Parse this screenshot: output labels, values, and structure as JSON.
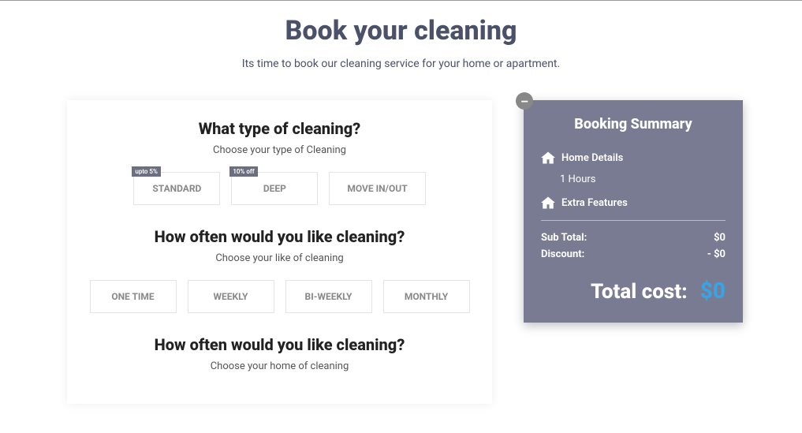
{
  "header": {
    "title": "Book your cleaning",
    "subtitle": "Its time to book our cleaning service for your home or apartment."
  },
  "form": {
    "section1": {
      "heading": "What type of cleaning?",
      "sub": "Choose your type of Cleaning",
      "options": {
        "standard": {
          "label": "STANDARD",
          "badge": "upto 5%"
        },
        "deep": {
          "label": "DEEP",
          "badge": "10% off"
        },
        "move": {
          "label": "MOVE IN/OUT"
        }
      }
    },
    "section2": {
      "heading": "How often would you like cleaning?",
      "sub": "Choose your like of cleaning",
      "options": {
        "one": "ONE TIME",
        "weekly": "WEEKLY",
        "biweekly": "BI-WEEKLY",
        "monthly": "MONTHLY"
      }
    },
    "section3": {
      "heading": "How often would you like cleaning?",
      "sub": "Choose your home of cleaning"
    }
  },
  "summary": {
    "title": "Booking Summary",
    "home_details_label": "Home Details",
    "hours": "1 Hours",
    "extra_label": "Extra Features",
    "subtotal_label": "Sub Total:",
    "subtotal_value": "$0",
    "discount_label": "Discount:",
    "discount_value": "- $0",
    "total_label": "Total cost:",
    "total_value": "$0",
    "toggle": "–"
  }
}
